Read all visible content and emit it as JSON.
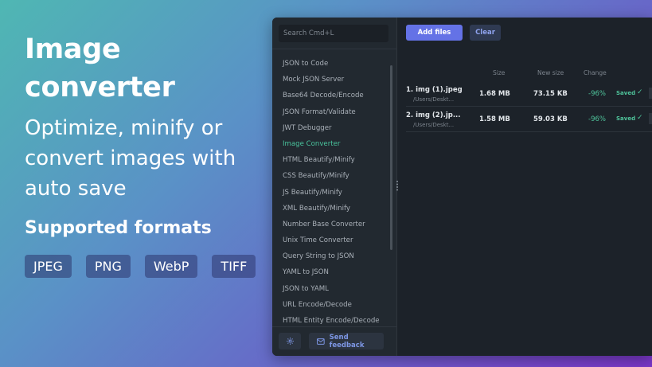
{
  "promo": {
    "title": "Image converter",
    "tagline": "Optimize, minify  or convert images with auto save",
    "formats_title": "Supported formats",
    "formats": [
      "JPEG",
      "PNG",
      "WebP",
      "TIFF"
    ]
  },
  "sidebar": {
    "search_placeholder": "Search Cmd+L",
    "items": [
      "JSON to Code",
      "Mock JSON Server",
      "Base64 Decode/Encode",
      "JSON Format/Validate",
      "JWT Debugger",
      "Image Converter",
      "HTML Beautify/Minify",
      "CSS Beautify/Minify",
      "JS Beautify/Minify",
      "XML Beautify/Minify",
      "Number Base Converter",
      "Unix Time Converter",
      "Query String to JSON",
      "YAML to JSON",
      "JSON to YAML",
      "URL Encode/Decode",
      "HTML Entity Encode/Decode"
    ],
    "active_item": "Image Converter",
    "feedback_label": "Send feedback"
  },
  "toolbar": {
    "add_label": "Add files",
    "clear_label": "Clear"
  },
  "table": {
    "headers": {
      "size": "Size",
      "new_size": "New size",
      "change": "Change"
    },
    "rows": [
      {
        "name": "1. img (1).jpeg",
        "path": "/Users/Deskt...",
        "size": "1.68 MB",
        "new_size": "73.15 KB",
        "change": "-96%",
        "status": "Saved"
      },
      {
        "name": "2. img (2).jp...",
        "path": "/Users/Deskt...",
        "size": "1.58 MB",
        "new_size": "59.03 KB",
        "change": "-96%",
        "status": "Saved"
      }
    ]
  },
  "colors": {
    "accent": "#6472e6",
    "active": "#49c39c",
    "success": "#4fc49b"
  }
}
